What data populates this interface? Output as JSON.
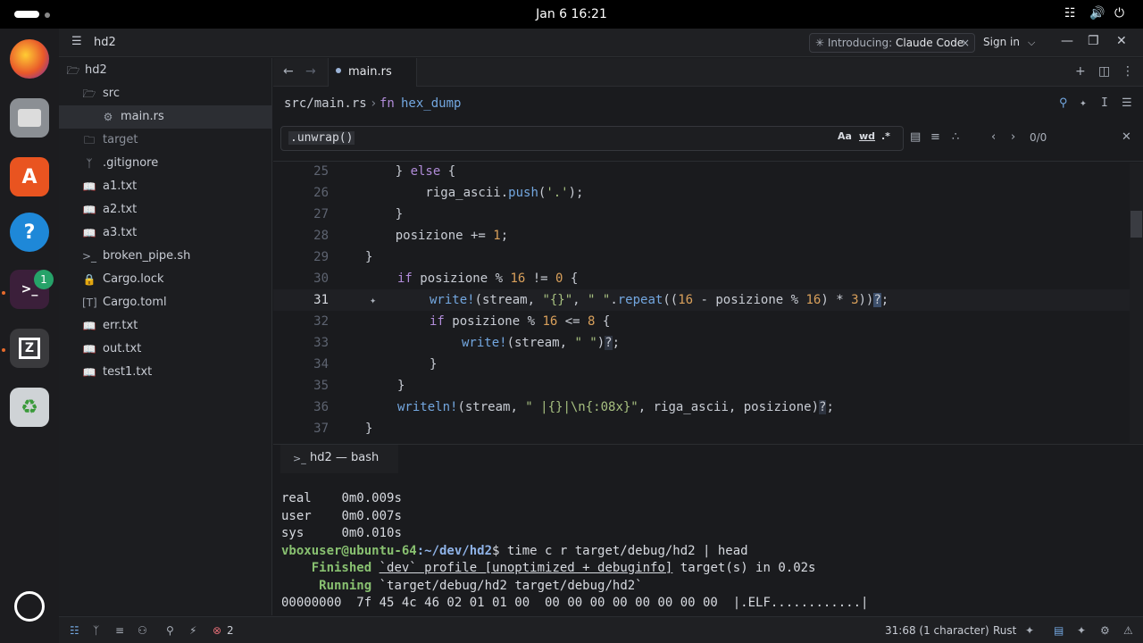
{
  "topbar": {
    "clock": "Jan 6  16:21"
  },
  "dock": {
    "terminal_badge": "1"
  },
  "titlebar": {
    "project": "hd2",
    "notice_prefix": "Introducing:",
    "notice_product": "Claude Code",
    "sign_in": "Sign in"
  },
  "sidebar": {
    "items": [
      {
        "label": "hd2"
      },
      {
        "label": "src"
      },
      {
        "label": "main.rs"
      },
      {
        "label": "target"
      },
      {
        "label": ".gitignore"
      },
      {
        "label": "a1.txt"
      },
      {
        "label": "a2.txt"
      },
      {
        "label": "a3.txt"
      },
      {
        "label": "broken_pipe.sh"
      },
      {
        "label": "Cargo.lock"
      },
      {
        "label": "Cargo.toml"
      },
      {
        "label": "err.txt"
      },
      {
        "label": "out.txt"
      },
      {
        "label": "test1.txt"
      }
    ]
  },
  "tabs": [
    {
      "label": "main.rs"
    }
  ],
  "breadcrumb": {
    "path": "src/main.rs",
    "sep": "›",
    "fn_kw": "fn",
    "fn_name": "hex_dump"
  },
  "find": {
    "query": ".unwrap()",
    "opt_case": "Aa",
    "opt_word": "wd",
    "opt_regex": ".*",
    "count": "0/0"
  },
  "editor": {
    "line_numbers": [
      "25",
      "26",
      "27",
      "28",
      "29",
      "30",
      "31",
      "32",
      "33",
      "34",
      "35",
      "36",
      "37"
    ],
    "current_line": "31"
  },
  "terminal": {
    "tab_title": "hd2 — bash",
    "lines": {
      "real_k": "real",
      "real_v": "0m0.009s",
      "user_k": "user",
      "user_v": "0m0.007s",
      "sys_k": "sys",
      "sys_v": "0m0.010s",
      "prompt": "vboxuser@ubuntu-64",
      "cwd": ":~/dev/hd2",
      "cmd": "$ time c r target/debug/hd2 | head",
      "finished_k": "Finished",
      "finished_profile": "`dev` profile [unoptimized + debuginfo]",
      "finished_rest": "target(s) in 0.02s",
      "running_k": "Running",
      "running_v": "`target/debug/hd2 target/debug/hd2`",
      "dump": "00000000  7f 45 4c 46 02 01 01 00  00 00 00 00 00 00 00 00  |.ELF............|"
    }
  },
  "status": {
    "errors": "2",
    "cursor": "31:68 (1 character)",
    "language": "Rust"
  }
}
